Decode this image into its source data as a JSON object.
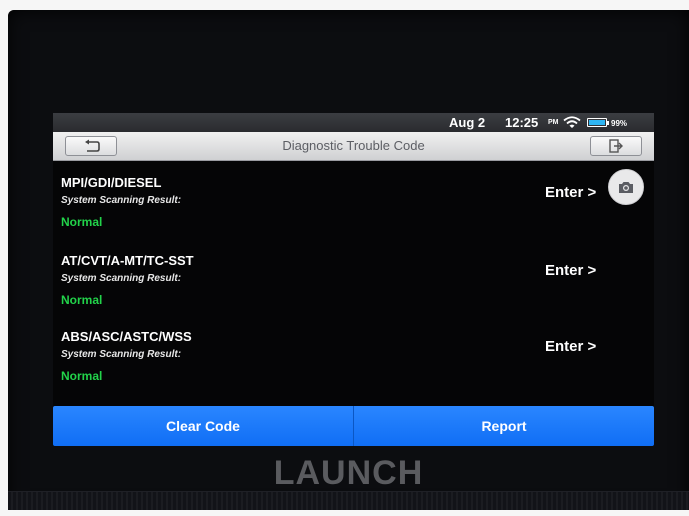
{
  "status_bar": {
    "date": "Aug 2",
    "time": "12:25",
    "ampm": "PM",
    "battery": "99%",
    "battery_level": 0.99,
    "icons": [
      "wifi-icon",
      "battery-icon"
    ]
  },
  "header": {
    "title": "Diagnostic Trouble Code",
    "back_icon": "back-arrow-icon",
    "exit_icon": "exit-icon"
  },
  "systems": [
    {
      "name": "MPI/GDI/DIESEL",
      "label": "System Scanning Result:",
      "result": "Normal",
      "action": "Enter >"
    },
    {
      "name": "AT/CVT/A-MT/TC-SST",
      "label": "System Scanning Result:",
      "result": "Normal",
      "action": "Enter >"
    },
    {
      "name": "ABS/ASC/ASTC/WSS",
      "label": "System Scanning Result:",
      "result": "Normal",
      "action": "Enter >"
    }
  ],
  "floating": {
    "icon": "camera-icon"
  },
  "footer": {
    "clear_label": "Clear Code",
    "report_label": "Report"
  },
  "device": {
    "brand": "LAUNCH"
  },
  "colors": {
    "accent": "#1b7cfb",
    "normal": "#22d34a",
    "background": "#050506"
  }
}
